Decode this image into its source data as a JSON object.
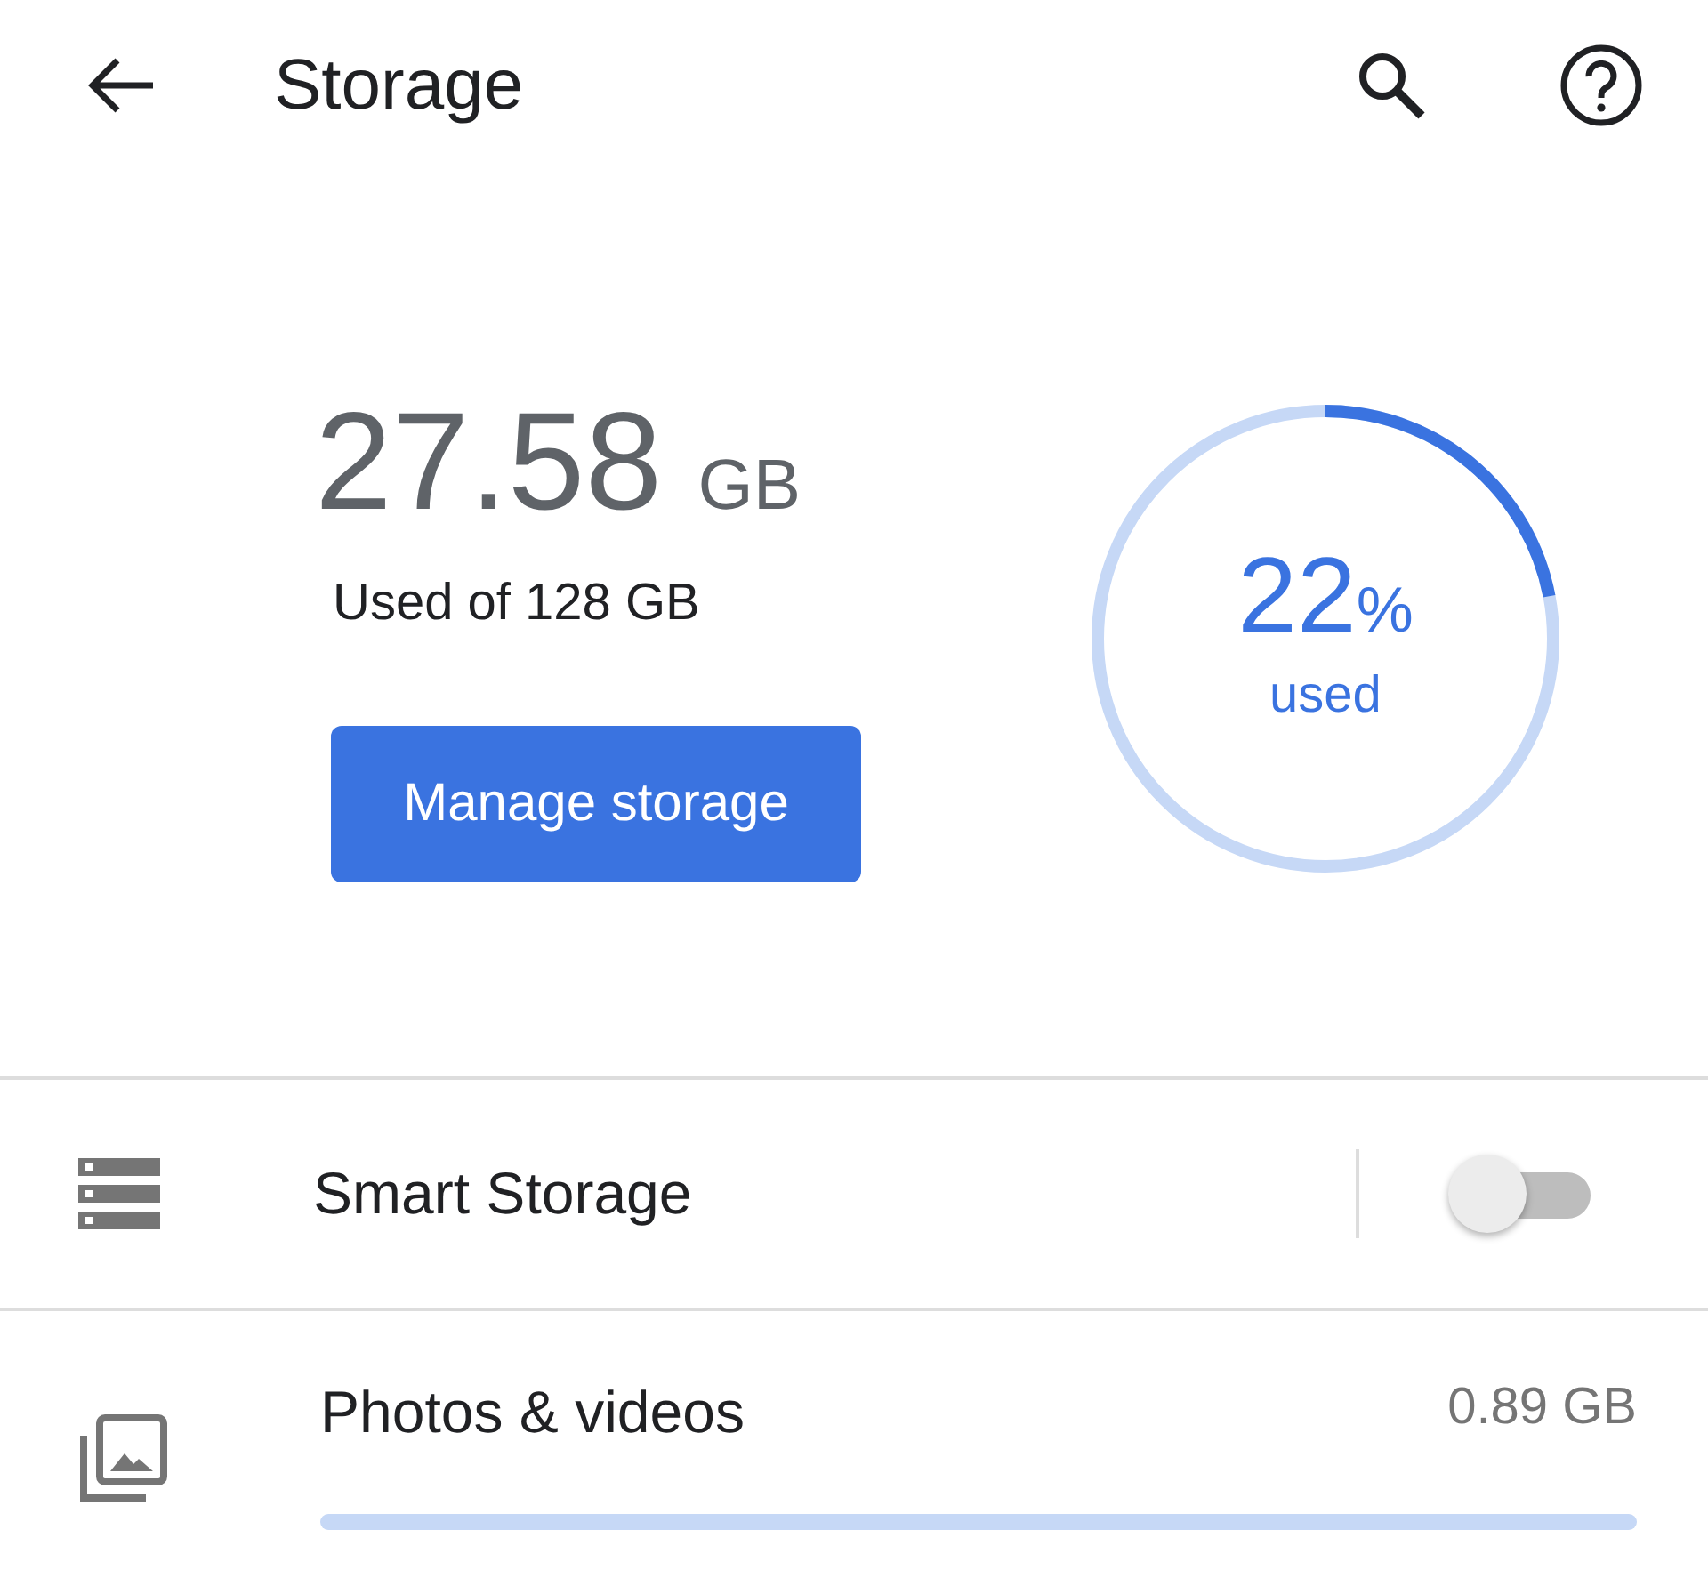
{
  "app_bar": {
    "title": "Storage"
  },
  "summary": {
    "used_amount": "27.58",
    "used_unit": "GB",
    "caption": "Used of 128 GB",
    "button": "Manage storage"
  },
  "usage_ring": {
    "percent": "22",
    "percent_sign": "%",
    "label": "used"
  },
  "settings": [
    {
      "kind": "toggle",
      "label": "Smart Storage",
      "on": false
    },
    {
      "kind": "category",
      "label": "Photos & videos",
      "size": "0.89 GB",
      "level": 0
    }
  ]
}
